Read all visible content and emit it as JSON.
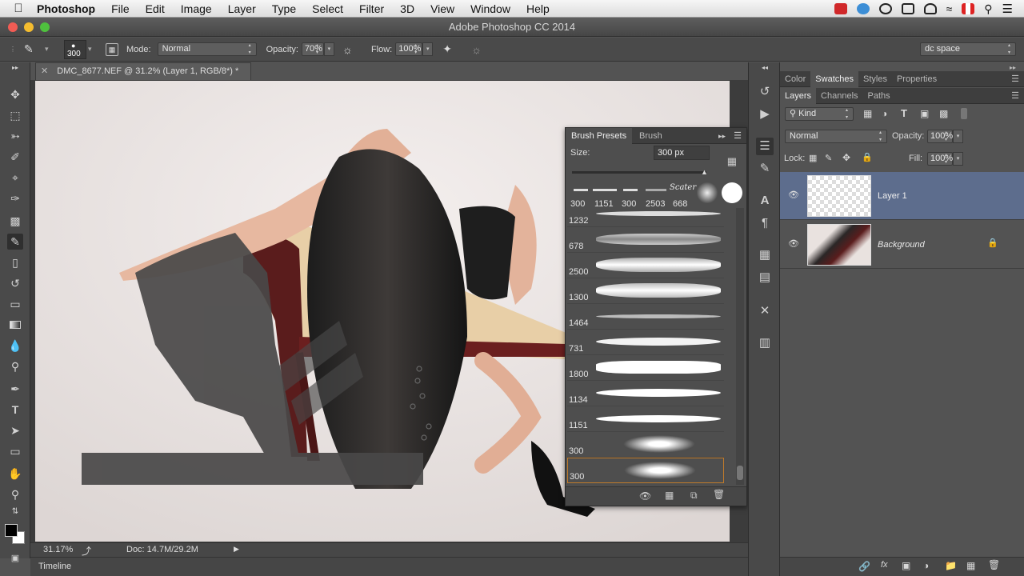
{
  "menubar": {
    "app_name": "Photoshop",
    "items": [
      "File",
      "Edit",
      "Image",
      "Layer",
      "Type",
      "Select",
      "Filter",
      "3D",
      "View",
      "Window",
      "Help"
    ]
  },
  "window": {
    "title": "Adobe Photoshop CC 2014"
  },
  "options_bar": {
    "brush_size": "300",
    "mode_label": "Mode:",
    "mode_value": "Normal",
    "opacity_label": "Opacity:",
    "opacity_value": "70%",
    "flow_label": "Flow:",
    "flow_value": "100%",
    "workspace": "dc space"
  },
  "document": {
    "tab_title": "DMC_8677.NEF @ 31.2% (Layer 1, RGB/8*) *",
    "zoom": "31.17%",
    "doc_size": "Doc: 14.7M/29.2M"
  },
  "timeline": {
    "label": "Timeline"
  },
  "panels": {
    "top_tabs": [
      "Color",
      "Swatches",
      "Styles",
      "Properties"
    ],
    "top_active": "Swatches",
    "layer_tabs": [
      "Layers",
      "Channels",
      "Paths"
    ],
    "kind_label": "Kind",
    "blend_mode": "Normal",
    "opacity_label": "Opacity:",
    "opacity_value": "100%",
    "lock_label": "Lock:",
    "fill_label": "Fill:",
    "fill_value": "100%",
    "layers": [
      {
        "name": "Layer 1",
        "selected": true
      },
      {
        "name": "Background",
        "selected": false,
        "locked": true
      }
    ]
  },
  "brush_panel": {
    "tabs": [
      "Brush Presets",
      "Brush"
    ],
    "size_label": "Size:",
    "size_value": "300 px",
    "top_presets": [
      "300",
      "1151",
      "300",
      "2503",
      "668"
    ],
    "top_preset_script": "Scater",
    "list": [
      "1232",
      "678",
      "2500",
      "1300",
      "1464",
      "731",
      "1800",
      "1134",
      "1151",
      "300",
      "300"
    ]
  }
}
